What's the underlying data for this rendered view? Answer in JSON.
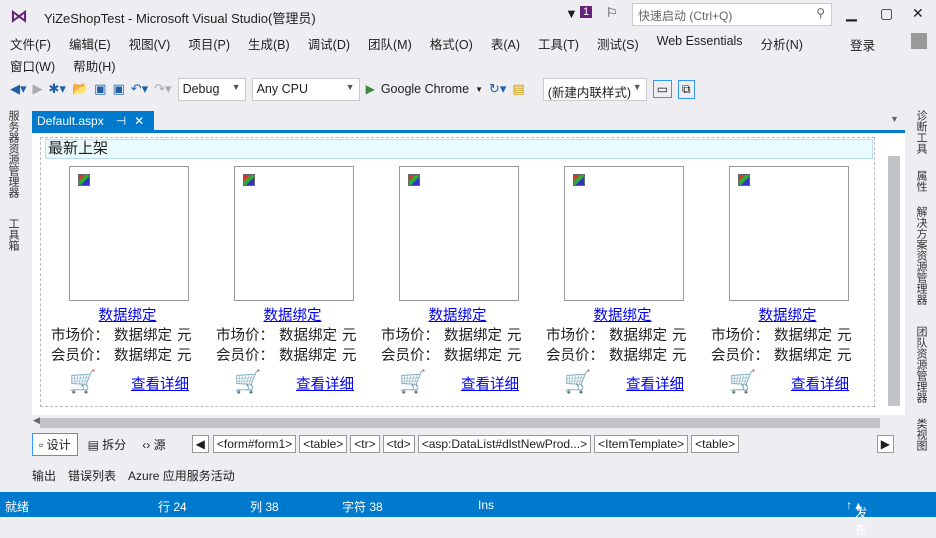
{
  "title": "YiZeShopTest - Microsoft Visual Studio(管理员)",
  "notification_count": "1",
  "quick_launch_placeholder": "快速启动 (Ctrl+Q)",
  "menu_row1": [
    "文件(F)",
    "编辑(E)",
    "视图(V)",
    "项目(P)",
    "生成(B)",
    "调试(D)",
    "团队(M)",
    "格式(O)",
    "表(A)",
    "工具(T)",
    "测试(S)",
    "Web Essentials",
    "分析(N)"
  ],
  "menu_row2": [
    "窗口(W)",
    "帮助(H)"
  ],
  "login": "登录",
  "toolbar": {
    "config": "Debug",
    "platform": "Any CPU",
    "run_target": "Google Chrome",
    "style": "(新建内联样式)"
  },
  "left_panels": [
    "服务器资源管理器",
    "工具箱"
  ],
  "right_panels": [
    "诊断工具",
    "属性",
    "解决方案资源管理器",
    "团队资源管理器",
    "类视图"
  ],
  "doc_tab": "Default.aspx",
  "section_header": "最新上架",
  "products": [
    {
      "name": "数据绑定",
      "market_label": "市场价：",
      "market": "数据绑定",
      "member_label": "会员价：",
      "member": "数据绑定",
      "unit": "元",
      "detail": "查看详细"
    },
    {
      "name": "数据绑定",
      "market_label": "市场价：",
      "market": "数据绑定",
      "member_label": "会员价：",
      "member": "数据绑定",
      "unit": "元",
      "detail": "查看详细"
    },
    {
      "name": "数据绑定",
      "market_label": "市场价：",
      "market": "数据绑定",
      "member_label": "会员价：",
      "member": "数据绑定",
      "unit": "元",
      "detail": "查看详细"
    },
    {
      "name": "数据绑定",
      "market_label": "市场价：",
      "market": "数据绑定",
      "member_label": "会员价：",
      "member": "数据绑定",
      "unit": "元",
      "detail": "查看详细"
    },
    {
      "name": "数据绑定",
      "market_label": "市场价：",
      "market": "数据绑定",
      "member_label": "会员价：",
      "member": "数据绑定",
      "unit": "元",
      "detail": "查看详细"
    }
  ],
  "views": [
    "设计",
    "拆分",
    "源"
  ],
  "breadcrumbs": [
    "<form#form1>",
    "<table>",
    "<tr>",
    "<td>",
    "<asp:DataList#dlstNewProd...>",
    "<ItemTemplate>",
    "<table>"
  ],
  "output_tabs": [
    "输出",
    "错误列表",
    "Azure 应用服务活动"
  ],
  "status": {
    "ready": "就绪",
    "line": "行 24",
    "col": "列 38",
    "char": "字符 38",
    "mode": "Ins",
    "publish": "发布"
  },
  "colors": {
    "accent": "#007acc",
    "vs_purple": "#68217a"
  }
}
